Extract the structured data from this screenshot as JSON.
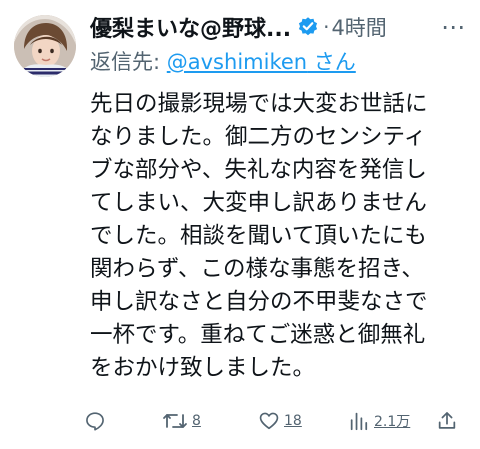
{
  "tweet": {
    "display_name": "優梨まいな@野球...",
    "verified_icon": "verified-badge-icon",
    "dot": "·",
    "time": "4時間",
    "more_icon": "more-icon",
    "more_label": "⋯",
    "reply_prefix": "返信先: ",
    "reply_handle": "@avshimiken",
    "reply_suffix": " さん",
    "body_lines": [
      "先日の撮影現場では大変お世話に",
      "なりました。御二方のセンシティ",
      "ブな部分や、失礼な内容を発信し",
      "てしまい、大変申し訳ありません",
      "でした。相談を聞いて頂いたにも",
      "関わらず、この様な事態を招き、",
      "申し訳なさと自分の不甲斐なさで",
      "一杯です。重ねてご迷惑と御無礼",
      "をおかけ致しました。"
    ],
    "actions": {
      "reply_icon": "reply-icon",
      "retweet_icon": "retweet-icon",
      "retweet_count": "8",
      "like_icon": "like-icon",
      "like_count": "18",
      "views_icon": "views-icon",
      "views_count": "2.1万",
      "share_icon": "share-icon"
    },
    "colors": {
      "text": "#0f1419",
      "secondary": "#536471",
      "link": "#1d9bf0",
      "verified": "#1d9bf0"
    }
  }
}
